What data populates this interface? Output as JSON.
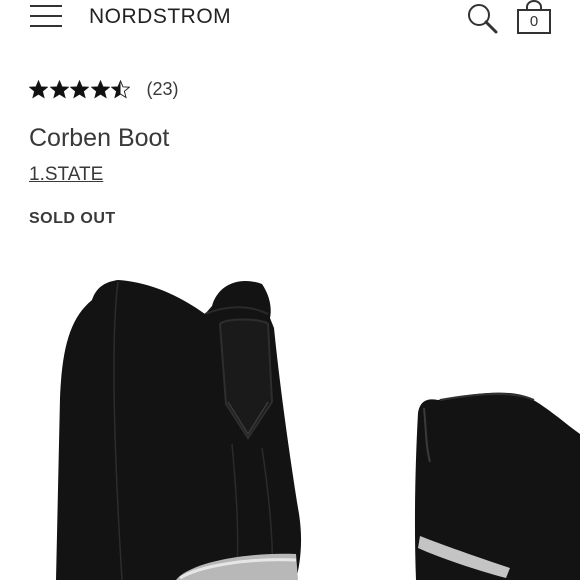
{
  "header": {
    "menu_icon": "hamburger-menu-icon",
    "logo": "NORDSTROM",
    "search_icon": "search-icon",
    "bag_icon": "shopping-bag-icon",
    "bag_count": "0"
  },
  "product": {
    "rating": 4.5,
    "rating_max": 5,
    "review_count": "(23)",
    "title": "Corben Boot",
    "brand": "1.STATE",
    "status": "SOLD OUT"
  },
  "colors": {
    "text": "#393939",
    "boot": "#121212",
    "background": "#ffffff"
  }
}
